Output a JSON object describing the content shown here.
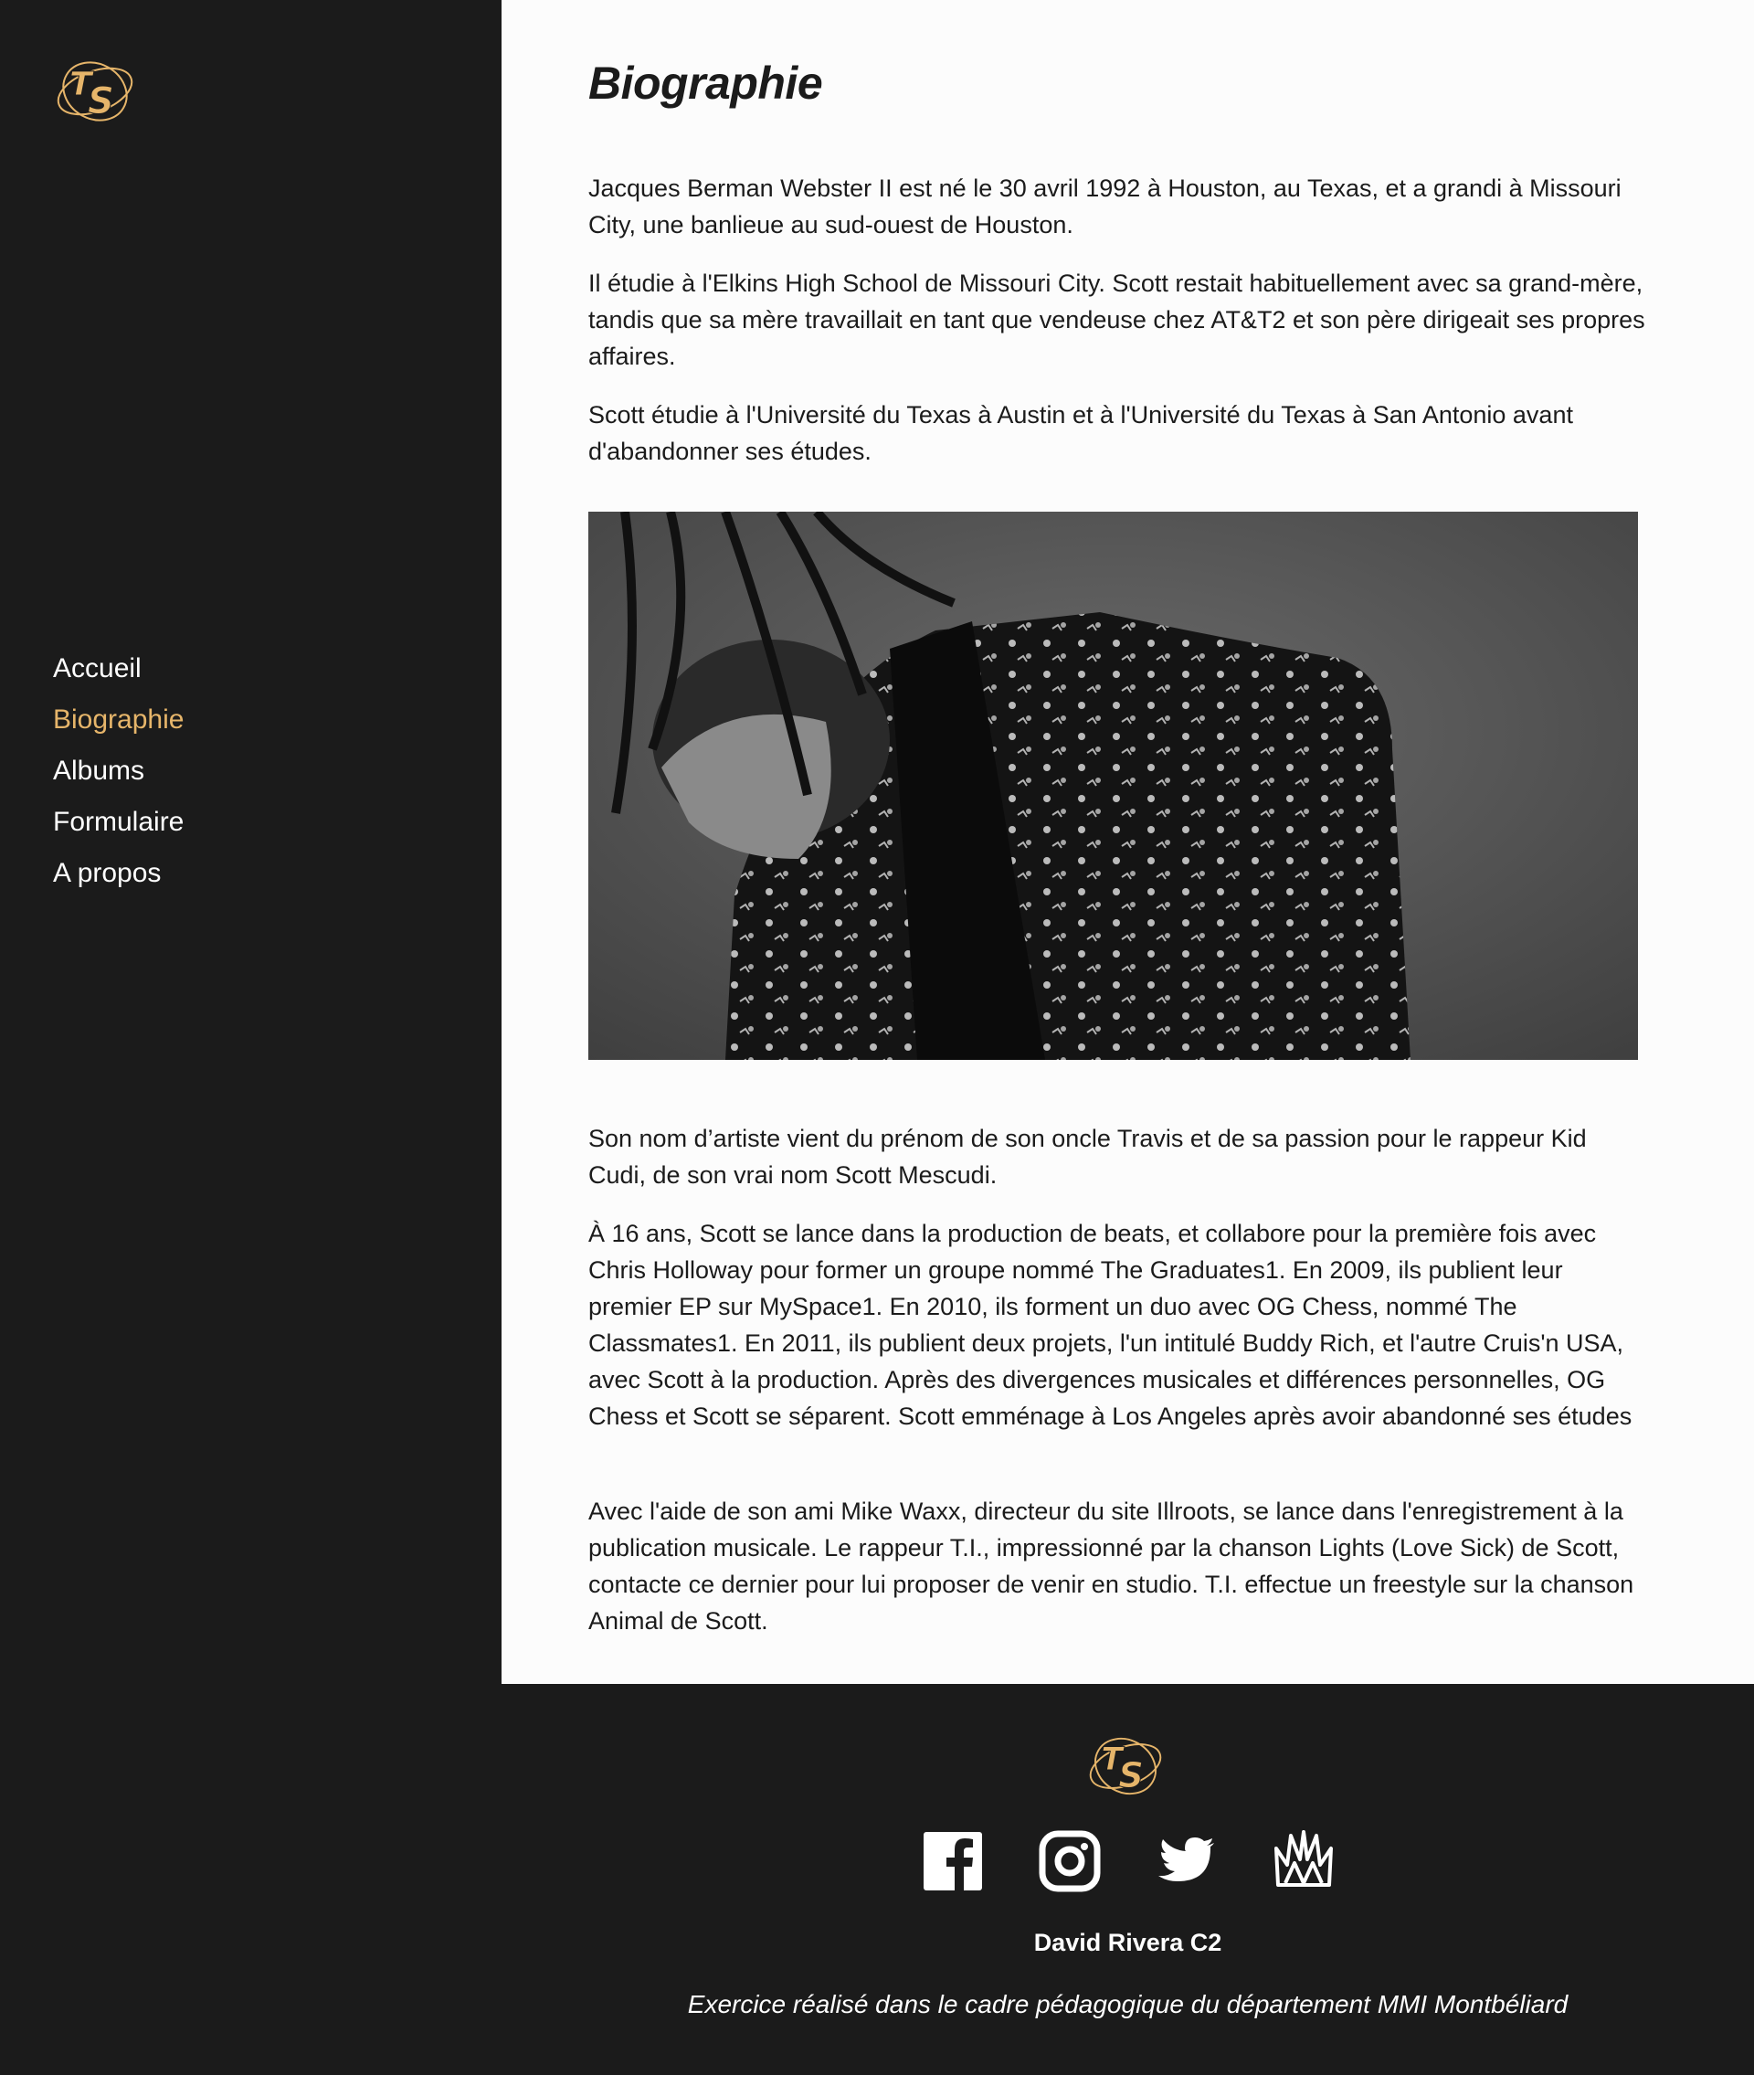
{
  "brand": {
    "logo_text": "TS",
    "accent_color": "#e6b56a"
  },
  "nav": {
    "items": [
      {
        "label": "Accueil",
        "active": false
      },
      {
        "label": "Biographie",
        "active": true
      },
      {
        "label": "Albums",
        "active": false
      },
      {
        "label": "Formulaire",
        "active": false
      },
      {
        "label": "A propos",
        "active": false
      }
    ]
  },
  "main": {
    "title": "Biographie",
    "paragraphs_top": [
      " Jacques Berman Webster II est né le 30 avril 1992 à Houston, au Texas, et a grandi à Missouri City, une banlieue au sud-ouest de Houston.",
      " Il étudie à l'Elkins High School de Missouri City. Scott restait habituellement avec sa grand-mère, tandis que sa mère travaillait en tant que vendeuse chez AT&T2 et son père dirigeait ses propres affaires.",
      "  Scott étudie à l'Université du Texas à Austin et à l'Université du Texas à San Antonio avant d'abandonner ses études."
    ],
    "paragraphs_bottom": [
      " Son nom d’artiste vient du prénom de son oncle Travis et de sa passion pour le rappeur Kid Cudi, de son vrai nom Scott Mescudi.",
      " À 16 ans, Scott se lance dans la production de beats, et collabore pour la première fois avec Chris Holloway pour former un groupe nommé The Graduates1. En 2009, ils publient leur premier EP sur MySpace1. En 2010, ils forment un duo avec OG Chess, nommé The Classmates1. En 2011, ils publient deux projets, l'un intitulé Buddy Rich, et l'autre Cruis'n USA, avec Scott à la production. Après des divergences musicales et différences personnelles, OG Chess et Scott se séparent. Scott emménage à Los Angeles après avoir abandonné ses études",
      " Avec l'aide de son ami Mike Waxx, directeur du site Illroots, se lance dans l'enregistrement à la publication musicale. Le rappeur T.I., impressionné par la chanson Lights (Love Sick) de Scott, contacte ce dernier pour lui proposer de venir en studio. T.I. effectue un freestyle sur la chanson Animal de Scott."
    ]
  },
  "footer": {
    "socials": [
      "facebook-icon",
      "instagram-icon",
      "twitter-icon",
      "astroworld-icon"
    ],
    "author": "David Rivera C2",
    "note": "Exercice réalisé dans le cadre pédagogique du département MMI Montbéliard"
  }
}
